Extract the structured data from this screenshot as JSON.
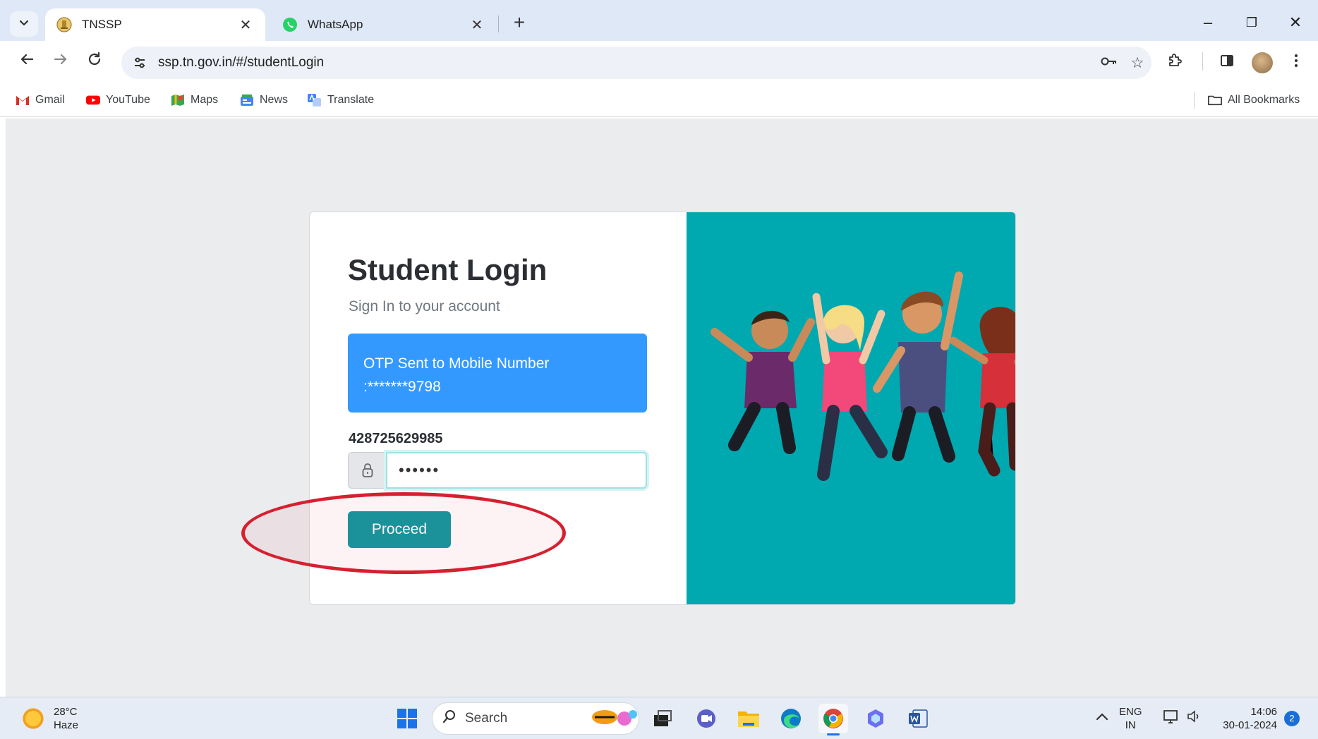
{
  "browser": {
    "tabs": [
      {
        "title": "TNSSP",
        "active": true
      },
      {
        "title": "WhatsApp",
        "active": false
      }
    ],
    "close_glyph": "✕",
    "new_tab_glyph": "+",
    "url": "ssp.tn.gov.in/#/studentLogin",
    "window_controls": {
      "minimize": "–",
      "restore": "❐",
      "close": "✕"
    }
  },
  "bookmarks": {
    "items": [
      {
        "label": "Gmail",
        "icon": "gmail-icon"
      },
      {
        "label": "YouTube",
        "icon": "youtube-icon"
      },
      {
        "label": "Maps",
        "icon": "maps-icon"
      },
      {
        "label": "News",
        "icon": "news-icon"
      },
      {
        "label": "Translate",
        "icon": "translate-icon"
      }
    ],
    "all_bookmarks": "All Bookmarks"
  },
  "login": {
    "title": "Student Login",
    "subtitle": "Sign In to your account",
    "alert_line1": "OTP Sent to Mobile Number",
    "alert_line2": ":*******9798",
    "aadhaar_number": "428725629985",
    "otp_value": "••••••",
    "proceed_label": "Proceed"
  },
  "colors": {
    "primary_teal": "#0f9aa0",
    "panel_teal": "#00a8b0",
    "alert_blue": "#3399ff",
    "annotation_red": "#d62030"
  },
  "taskbar": {
    "temperature": "28°C",
    "condition": "Haze",
    "search_label": "Search",
    "language_top": "ENG",
    "language_bottom": "IN",
    "time": "14:06",
    "date": "30-01-2024",
    "notification_count": "2"
  }
}
